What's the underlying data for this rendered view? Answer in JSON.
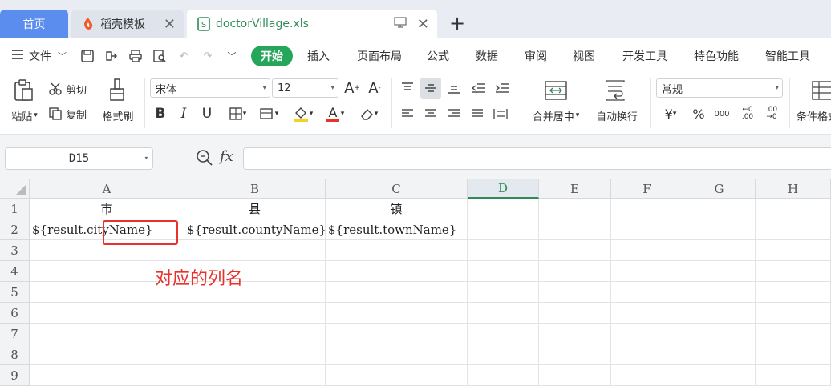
{
  "tabs": [
    {
      "label": "首页"
    },
    {
      "label": "稻壳模板"
    },
    {
      "label": "doctorVillage.xls"
    }
  ],
  "menu": {
    "file_label": "文件",
    "items": [
      "开始",
      "插入",
      "页面布局",
      "公式",
      "数据",
      "审阅",
      "视图",
      "开发工具",
      "特色功能",
      "智能工具"
    ]
  },
  "ribbon": {
    "paste": "粘贴",
    "cut": "剪切",
    "copy": "复制",
    "format_painter": "格式刷",
    "font_name": "宋体",
    "font_size": "12",
    "bold": "B",
    "italic": "I",
    "underline": "U",
    "merge_center": "合并居中",
    "wrap_text": "自动换行",
    "number_format": "常规",
    "conditional_format": "条件格式"
  },
  "formula_bar": {
    "cell_ref": "D15",
    "formula": ""
  },
  "sheet": {
    "columns": [
      "A",
      "B",
      "C",
      "D",
      "E",
      "F",
      "G",
      "H"
    ],
    "active_column": "D",
    "rows": [
      "1",
      "2",
      "3",
      "4",
      "5",
      "6",
      "7",
      "8",
      "9"
    ],
    "header_row": [
      "市",
      "县",
      "镇"
    ],
    "data_row": [
      "${result.cityName}",
      "${result.countyName}",
      "${result.townName}"
    ]
  },
  "annotation": {
    "text": "对应的列名",
    "color": "#e8322b"
  },
  "colors": {
    "accent_green": "#26a65b",
    "home_tab_blue": "#5b8def"
  }
}
